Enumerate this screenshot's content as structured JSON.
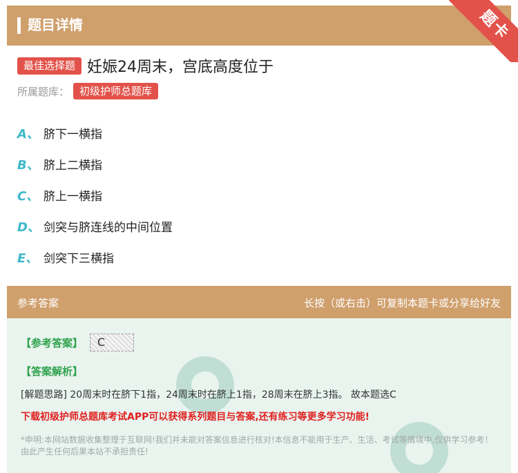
{
  "header": {
    "title": "题目详情"
  },
  "ribbon": {
    "label": "题卡"
  },
  "question": {
    "type_tag": "最佳选择题",
    "text": "妊娠24周末，宫底高度位于",
    "library_label": "所属题库：",
    "library_name": "初级护师总题库"
  },
  "options": [
    {
      "letter": "A、",
      "text": "脐下一横指"
    },
    {
      "letter": "B、",
      "text": "脐上二横指"
    },
    {
      "letter": "C、",
      "text": "脐上一横指"
    },
    {
      "letter": "D、",
      "text": "剑突与脐连线的中间位置"
    },
    {
      "letter": "E、",
      "text": "剑突下三横指"
    }
  ],
  "answer_section": {
    "title": "参考答案",
    "hint": "长按（或右击）可复制本题卡或分享给好友",
    "answer_label": "【参考答案】",
    "answer_value": "C",
    "analysis_label": "【答案解析】",
    "analysis_text": "[解题思路] 20周末时在脐下1指，24周末时在脐上1指，28周末在脐上3指。 故本题选C",
    "promo": "下载初级护师总题库考试APP可以获得系列题目与答案,还有练习等更多学习功能!",
    "disclaimer": "*申明:本网站数据收集整理于互联网!我们并未能对答案信息进行核对!本信息不能用于生产、生活、考试等情境中,仅供学习参考！由此产生任何后果本站不承担责任!"
  },
  "colors": {
    "accent": "#cf9f6c",
    "tag": "#e2524a",
    "option_letter": "#3fb8c9",
    "answer_bg": "#e9f4ef"
  }
}
